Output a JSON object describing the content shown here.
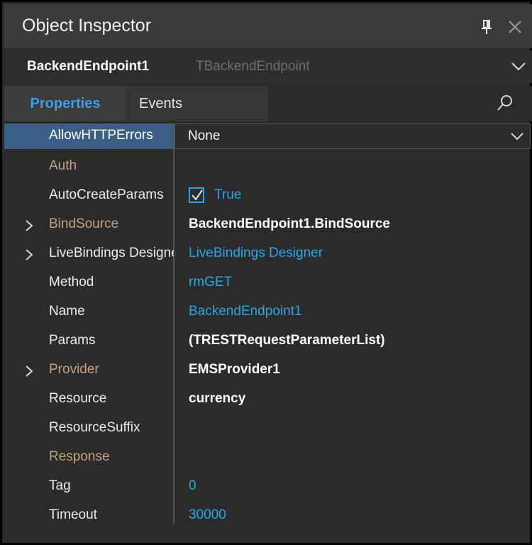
{
  "window": {
    "title": "Object Inspector",
    "pin_icon": "pin-icon",
    "close_icon": "close-icon"
  },
  "selector": {
    "object_name": "BackendEndpoint1",
    "object_type": "TBackendEndpoint"
  },
  "tabs": {
    "properties": "Properties",
    "events": "Events",
    "search_icon": "search-icon"
  },
  "colors": {
    "accent": "#29a8e8",
    "selected_row": "#3a5f87",
    "event_property": "#c2a57d",
    "background": "#2b2b2b"
  },
  "properties": [
    {
      "name": "AllowHTTPErrors",
      "value": "None",
      "selected": true
    },
    {
      "name": "Auth",
      "value": ""
    },
    {
      "name": "AutoCreateParams",
      "value": "True",
      "checked": true
    },
    {
      "name": "BindSource",
      "value": "BackendEndpoint1.BindSource",
      "expandable": true
    },
    {
      "name": "LiveBindings Designer",
      "value": "LiveBindings Designer",
      "expandable": true
    },
    {
      "name": "Method",
      "value": "rmGET"
    },
    {
      "name": "Name",
      "value": "BackendEndpoint1"
    },
    {
      "name": "Params",
      "value": "(TRESTRequestParameterList)"
    },
    {
      "name": "Provider",
      "value": "EMSProvider1",
      "expandable": true
    },
    {
      "name": "Resource",
      "value": "currency"
    },
    {
      "name": "ResourceSuffix",
      "value": ""
    },
    {
      "name": "Response",
      "value": ""
    },
    {
      "name": "Tag",
      "value": "0"
    },
    {
      "name": "Timeout",
      "value": "30000"
    }
  ]
}
